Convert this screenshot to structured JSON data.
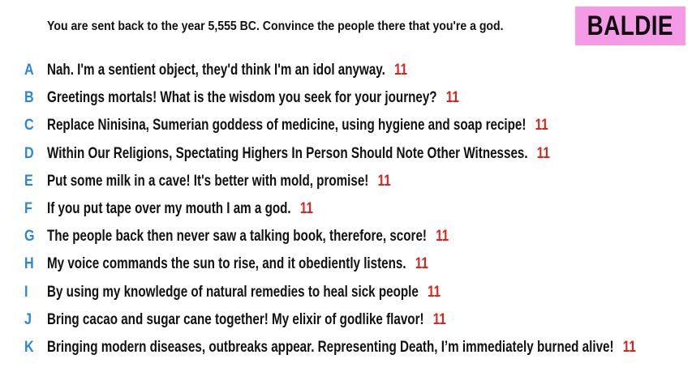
{
  "prompt": "You are sent back to the year 5,555 BC. Convince the people there that you're a god.",
  "badge": {
    "label": "BALDIE",
    "color": "#f59be6"
  },
  "colors": {
    "letter": "#2b86d8",
    "score": "#e0201b",
    "text": "#111111"
  },
  "answers": [
    {
      "letter": "A",
      "text": "Nah. I'm a sentient object, they'd think I'm an idol anyway.",
      "score": "11"
    },
    {
      "letter": "B",
      "text": "Greetings mortals! What is the wisdom you seek for your journey?",
      "score": "11"
    },
    {
      "letter": "C",
      "text": "Replace Ninisina, Sumerian goddess of medicine, using hygiene and soap recipe!",
      "score": "11"
    },
    {
      "letter": "D",
      "text": "Within Our Religions, Spectating Highers In Person Should Note Other Witnesses.",
      "score": "11"
    },
    {
      "letter": "E",
      "text": "Put some milk in a cave! It's better with mold, promise!",
      "score": "11"
    },
    {
      "letter": "F",
      "text": "If you put tape over my mouth I am a god.",
      "score": "11"
    },
    {
      "letter": "G",
      "text": "The people back then never saw a talking book, therefore, score!",
      "score": "11"
    },
    {
      "letter": "H",
      "text": "My voice commands the sun to rise, and it obediently listens.",
      "score": "11"
    },
    {
      "letter": "I",
      "text": "By using my knowledge of natural remedies to heal sick people",
      "score": "11"
    },
    {
      "letter": "J",
      "text": "Bring cacao and sugar cane together! My elixir of godlike flavor!",
      "score": "11"
    },
    {
      "letter": "K",
      "text": "Bringing modern diseases, outbreaks appear. Representing Death, I’m immediately burned alive!",
      "score": "11"
    }
  ]
}
